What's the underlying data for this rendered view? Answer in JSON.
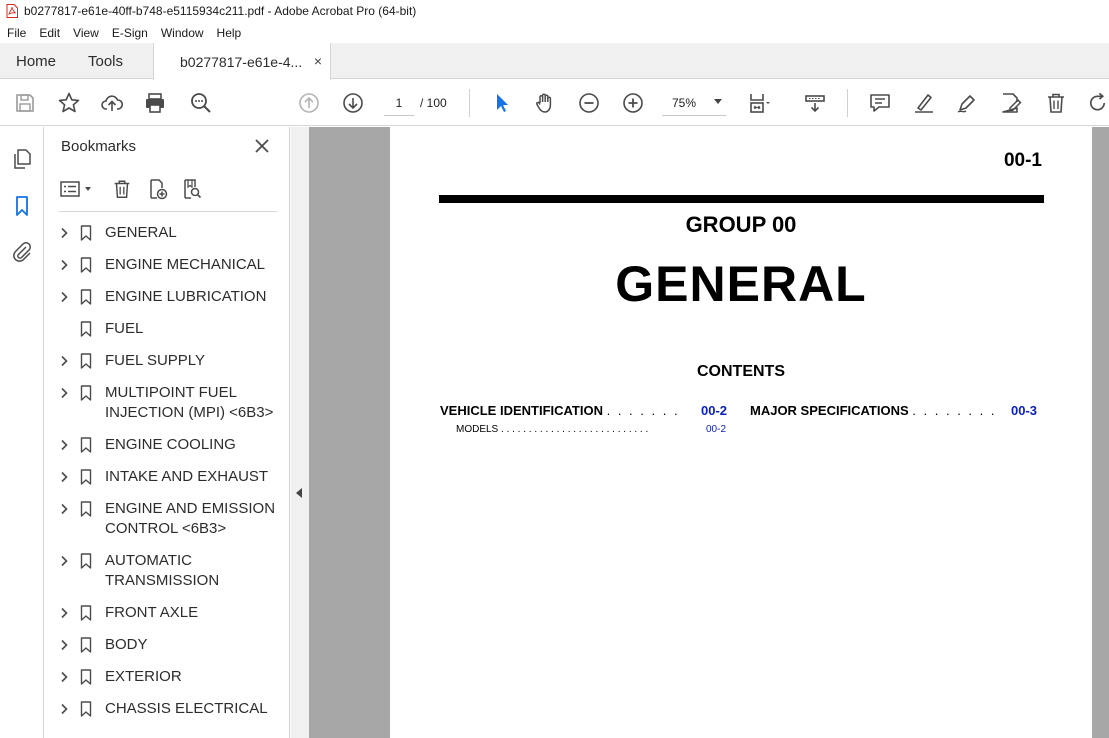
{
  "window": {
    "title": "b0277817-e61e-40ff-b748-e5115934c211.pdf - Adobe Acrobat Pro (64-bit)"
  },
  "menu": [
    "File",
    "Edit",
    "View",
    "E-Sign",
    "Window",
    "Help"
  ],
  "tabs": {
    "home": "Home",
    "tools": "Tools",
    "document": "b0277817-e61e-4...",
    "close": "×"
  },
  "toolbar": {
    "current_page": "1",
    "total_pages": "/ 100",
    "zoom": "75%"
  },
  "bookmarks": {
    "header": "Bookmarks",
    "items": [
      {
        "label": "GENERAL",
        "expandable": true
      },
      {
        "label": "ENGINE MECHANICAL",
        "expandable": true
      },
      {
        "label": "ENGINE LUBRICATION",
        "expandable": true
      },
      {
        "label": "FUEL",
        "expandable": false
      },
      {
        "label": "FUEL SUPPLY",
        "expandable": true
      },
      {
        "label": "MULTIPOINT FUEL INJECTION (MPI) <6B3>",
        "expandable": true
      },
      {
        "label": "ENGINE COOLING",
        "expandable": true
      },
      {
        "label": "INTAKE AND EXHAUST",
        "expandable": true
      },
      {
        "label": "ENGINE AND EMISSION CONTROL <6B3>",
        "expandable": true
      },
      {
        "label": "AUTOMATIC TRANSMISSION",
        "expandable": true
      },
      {
        "label": "FRONT AXLE",
        "expandable": true
      },
      {
        "label": "BODY",
        "expandable": true
      },
      {
        "label": "EXTERIOR",
        "expandable": true
      },
      {
        "label": "CHASSIS ELECTRICAL",
        "expandable": true
      }
    ]
  },
  "document": {
    "page_number": "00-1",
    "group": "GROUP 00",
    "title": "GENERAL",
    "contents": "CONTENTS",
    "toc": {
      "left_entry": "VEHICLE IDENTIFICATION",
      "left_dots": ". . . . . . .",
      "left_page": "00-2",
      "left_sub": "MODELS",
      "left_sub_dots": ". . . . . . . . . . . . . . . . . . . . . . . . . . .",
      "left_sub_page": "00-2",
      "right_entry": "MAJOR SPECIFICATIONS",
      "right_dots": ". . . . . . . .",
      "right_page": "00-3"
    }
  },
  "colors": {
    "link_blue": "#0a1fbf",
    "pointer_blue": "#1473e6",
    "viewer_gray": "#a7a7a7",
    "icon_gray": "#4b4b4b"
  }
}
